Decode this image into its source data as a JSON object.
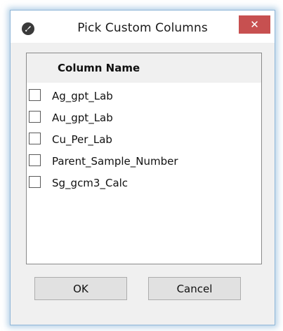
{
  "window": {
    "title": "Pick Custom Columns",
    "close_label": "✕"
  },
  "table": {
    "header": "Column Name",
    "rows": [
      {
        "label": "Ag_gpt_Lab",
        "checked": false
      },
      {
        "label": "Au_gpt_Lab",
        "checked": false
      },
      {
        "label": "Cu_Per_Lab",
        "checked": false
      },
      {
        "label": "Parent_Sample_Number",
        "checked": false
      },
      {
        "label": "Sg_gcm3_Calc",
        "checked": false
      }
    ]
  },
  "buttons": {
    "ok_label": "OK",
    "cancel_label": "Cancel"
  },
  "icons": {
    "app": "app-icon",
    "close": "close-icon",
    "checkbox": "checkbox-icon"
  },
  "colors": {
    "close_button": "#c75050",
    "window_border": "#8fb6d8"
  }
}
